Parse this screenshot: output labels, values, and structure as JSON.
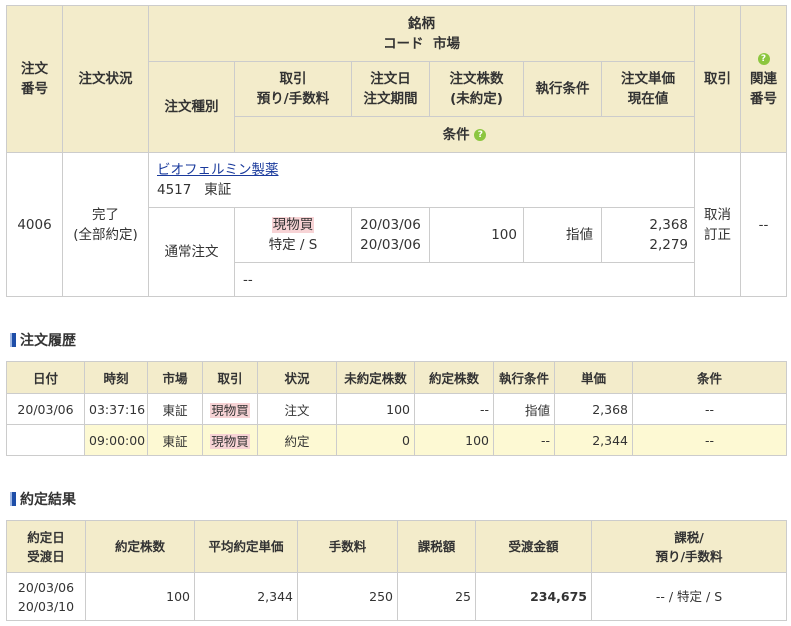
{
  "order_table": {
    "headers": {
      "order_no": "注文\n番号",
      "status": "注文状況",
      "stock": "銘柄",
      "code_market": "コード  市場",
      "order_type": "注文種別",
      "trade": "取引\n預り/手数料",
      "order_date": "注文日\n注文期間",
      "quantity": "注文株数\n(未約定)",
      "exec_cond": "執行条件",
      "unit_price": "注文単価\n現在値",
      "torihiki": "取引",
      "related": "関連\n番号",
      "conditions": "条件"
    },
    "row": {
      "order_no": "4006",
      "status": "完了\n(全部約定)",
      "stock_name": "ビオフェルミン製薬",
      "code_market": "4517   東証",
      "order_type": "通常注文",
      "trade_type": "現物買",
      "account": "特定 / S",
      "order_date": "20/03/06",
      "period": "20/03/06",
      "quantity": "100",
      "exec_cond": "指値",
      "unit_price": "2,368",
      "current_price": "2,279",
      "action_cancel": "取消",
      "action_modify": "訂正",
      "related": "--",
      "conditions": "--"
    }
  },
  "history": {
    "title": "注文履歴",
    "headers": [
      "日付",
      "時刻",
      "市場",
      "取引",
      "状況",
      "未約定株数",
      "約定株数",
      "執行条件",
      "単価",
      "条件"
    ],
    "rows": [
      {
        "date": "20/03/06",
        "time": "03:37:16",
        "market": "東証",
        "trade": "現物買",
        "status": "注文",
        "unfilled": "100",
        "filled": "--",
        "cond": "指値",
        "price": "2,368",
        "cond2": "--"
      },
      {
        "date": "",
        "time": "09:00:00",
        "market": "東証",
        "trade": "現物買",
        "status": "約定",
        "unfilled": "0",
        "filled": "100",
        "cond": "--",
        "price": "2,344",
        "cond2": "--"
      }
    ]
  },
  "result": {
    "title": "約定結果",
    "headers": {
      "date": "約定日\n受渡日",
      "qty": "約定株数",
      "avg": "平均約定単価",
      "fee": "手数料",
      "tax": "課税額",
      "amount": "受渡金額",
      "taxacc": "課税/\n預り/手数料"
    },
    "row": {
      "trade_date": "20/03/06",
      "settle_date": "20/03/10",
      "qty": "100",
      "avg": "2,344",
      "fee": "250",
      "tax": "25",
      "amount": "234,675",
      "taxacc": "-- / 特定 / S"
    }
  },
  "colors": {
    "header_bg": "#f3eccb",
    "highlight_row": "#fdf9d3",
    "tag_bg": "#f7d3d5",
    "link": "#1a3a9c",
    "help_icon": "#8cc63f"
  }
}
